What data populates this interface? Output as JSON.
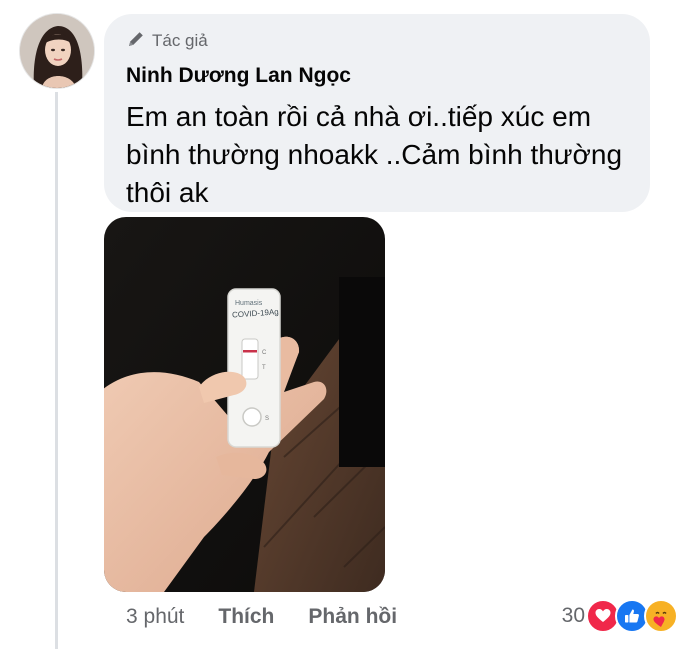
{
  "comment": {
    "badge_label": "Tác giả",
    "badge_icon": "pencil-icon",
    "author": "Ninh Dương Lan Ngọc",
    "text": "Em an toàn rồi cả nhà ơi..tiếp xúc em bình thường nhoakk ..Cảm bình thường thôi ak"
  },
  "photo": {
    "kit_brand": "Humasis",
    "kit_label": "COVID-19Ag",
    "mark_c": "C",
    "mark_t": "T",
    "mark_s": "S"
  },
  "footer": {
    "time": "3 phút",
    "like_label": "Thích",
    "reply_label": "Phản hồi",
    "reaction_count": "30",
    "reactions": [
      "heart-icon",
      "like-icon",
      "care-icon"
    ]
  },
  "colors": {
    "bubble_bg": "#eff1f4",
    "heart": "#f0284a",
    "like": "#1877f2",
    "care": "#f7b125"
  }
}
